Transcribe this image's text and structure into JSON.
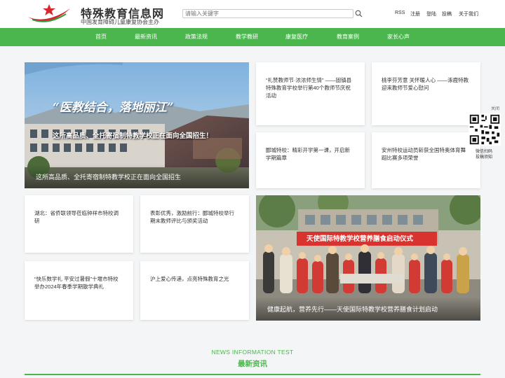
{
  "header": {
    "title": "特殊教育信息网",
    "subtitle": "中国发育障碍儿童康复协会主办",
    "search_placeholder": "请输入关键字",
    "links": [
      "RSS",
      "注册",
      "登陆",
      "投稿",
      "关于我们"
    ]
  },
  "nav": {
    "items": [
      "首页",
      "最新资讯",
      "政策法规",
      "教学教研",
      "康复医疗",
      "教育案例",
      "家长心声"
    ]
  },
  "featured": {
    "banner_text": "“医教结合，落地丽江”",
    "overlay_text": "这所高品质、全托寄宿制特教学校正在面向全国招生！",
    "caption": "这所高品质、全托寄宿制特教学校正在面向全国招生"
  },
  "news_cards": [
    "“礼赞教师节·浓浓师生情” ——固镇县特殊教育学校举行第40个教师节庆祝活动",
    "桃李芬芳意 关怀暖人心 ——涿鹿特教迎来教师节爱心慰问",
    "郾城特校：精彩开学第一课，开启新学期篇章",
    "安州特校运动员斩获全国特奥体育舞蹈比赛多项荣誉",
    "湖北：省侨联领导莅临钟祥市特校调研",
    "表彰优秀，激励前行：郾城特校举行期末教师评比与颁奖活动",
    "“快乐数学礼 平安过暑假”十堰市特校举办2024年春季学期散学典礼",
    "沪上爱心传递，点亮特殊教育之光"
  ],
  "photo": {
    "banner_text": "天使国际特教学校营养膳食启动仪式",
    "caption": "健康起航，营养先行——天使国际特教学校营养膳食计划启动"
  },
  "qr": {
    "close": "关闭",
    "label1": "微信扫码",
    "label2": "投稿须知"
  },
  "section": {
    "en": "NEWS INFORMATION TEST",
    "cn": "最新资讯"
  },
  "colors": {
    "accent": "#4cb64e",
    "logo_red": "#d7262d"
  }
}
